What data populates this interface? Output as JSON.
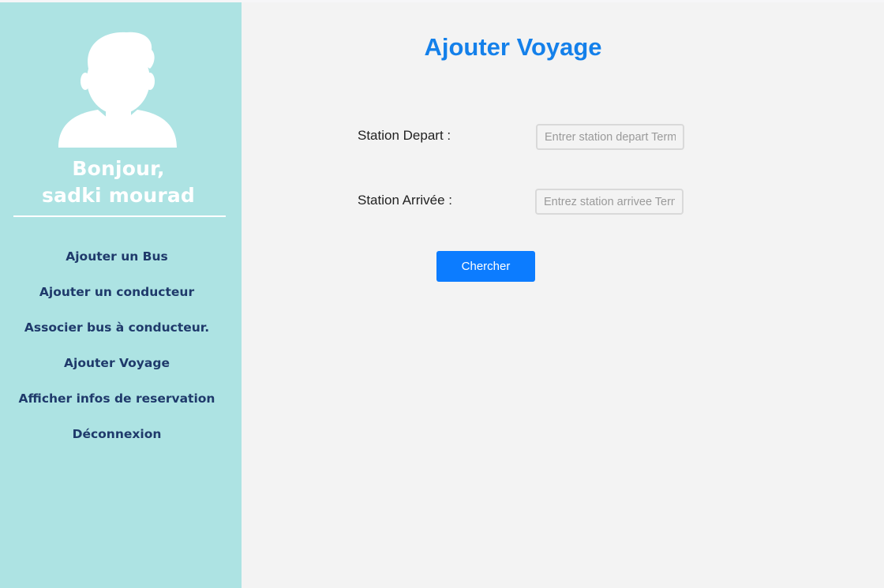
{
  "sidebar": {
    "avatar_icon": "user-silhouette-icon",
    "greeting": {
      "line1": "Bonjour,",
      "line2": "sadki mourad"
    },
    "nav_items": [
      {
        "label": "Ajouter un Bus"
      },
      {
        "label": "Ajouter un conducteur"
      },
      {
        "label": "Associer bus à conducteur."
      },
      {
        "label": "Ajouter Voyage"
      },
      {
        "label": "Afficher infos de reservation"
      },
      {
        "label": "Déconnexion"
      }
    ]
  },
  "main": {
    "title": "Ajouter Voyage",
    "departure": {
      "label": "Station Depart :",
      "placeholder": "Entrer station depart Terminus",
      "value": ""
    },
    "arrival": {
      "label": "Station Arrivée :",
      "placeholder": "Entrez station arrivee Terminus",
      "value": ""
    },
    "search_button": "Chercher"
  },
  "colors": {
    "sidebar_bg": "#ade3e3",
    "nav_text": "#1f3a6b",
    "title": "#1480ea",
    "button": "#0c7cff",
    "page_bg": "#f3f3f3"
  }
}
